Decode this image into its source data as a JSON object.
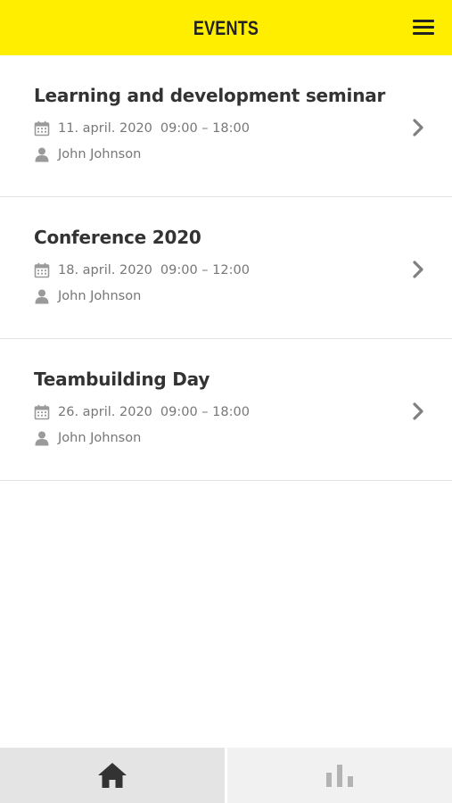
{
  "header": {
    "title": "EVENTS"
  },
  "events": [
    {
      "title": "Learning and development seminar",
      "date": "11. april. 2020",
      "time": "09:00 – 18:00",
      "person": "John Johnson"
    },
    {
      "title": "Conference 2020",
      "date": "18. april. 2020",
      "time": "09:00 – 12:00",
      "person": "John Johnson"
    },
    {
      "title": "Teambuilding Day",
      "date": "26. april. 2020",
      "time": "09:00 – 18:00",
      "person": "John Johnson"
    }
  ],
  "tabbar": {
    "tabs": [
      {
        "icon": "home-icon",
        "active": true
      },
      {
        "icon": "bar-chart-icon",
        "active": false
      }
    ]
  },
  "colors": {
    "header_bg": "#ffee00",
    "text_primary": "#333333",
    "text_secondary": "#777777",
    "icon_gray": "#9a9a9a",
    "tab_active_bg": "#e4e4e4",
    "tab_inactive_bg": "#f1f1f1"
  }
}
